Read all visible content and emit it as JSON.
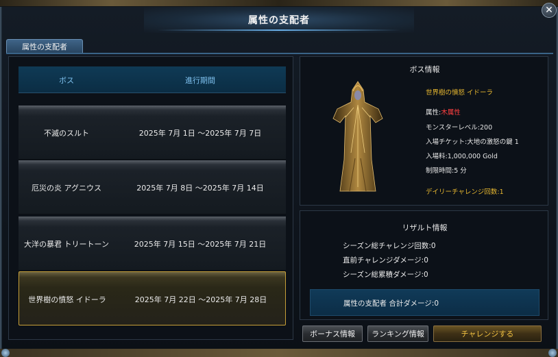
{
  "window": {
    "title": "属性の支配者",
    "close_glyph": "✕"
  },
  "tabs": [
    {
      "label": "属性の支配者"
    }
  ],
  "list": {
    "headers": {
      "boss": "ボス",
      "period": "進行期間"
    },
    "rows": [
      {
        "boss": "不滅のスルト",
        "period": "2025年 7月 1日 ～2025年 7月 7日"
      },
      {
        "boss": "厄災の炎 アグニウス",
        "period": "2025年 7月 8日 ～2025年 7月 14日"
      },
      {
        "boss": "大洋の暴君 トリートーン",
        "period": "2025年 7月 15日 ～2025年 7月 21日"
      },
      {
        "boss": "世界樹の憤怒 イドーラ",
        "period": "2025年 7月 22日 ～2025年 7月 28日"
      }
    ],
    "selected_index": 3
  },
  "boss_info": {
    "title": "ボス情報",
    "name": "世界樹の憤怒 イドーラ",
    "attribute_label": "属性:",
    "attribute_value": "木属性",
    "monster_level": "モンスターレベル:200",
    "ticket": "入場チケット:大地の激怒の鍵 1",
    "fee": "入場料:1,000,000 Gold",
    "time_limit": "制限時間:5 分",
    "daily_challenges": "デイリーチャレンジ回数:1"
  },
  "result": {
    "title": "リザルト情報",
    "season_challenges": "シーズン総チャレンジ回数:0",
    "last_damage": "直前チャレンジダメージ:0",
    "season_total_damage": "シーズン総累積ダメージ:0",
    "ruler_total_damage": "属性の支配者 合計ダメージ:0"
  },
  "buttons": {
    "bonus": "ボーナス情報",
    "ranking": "ランキング情報",
    "challenge": "チャレンジする"
  },
  "colors": {
    "accent_blue": "#7ec0ee",
    "gold": "#e8b830",
    "attribute_red": "#ff4040",
    "selected_border": "#c8a038"
  },
  "icons": {
    "close": "close-icon",
    "boss_portrait": "boss-portrait-icon"
  }
}
